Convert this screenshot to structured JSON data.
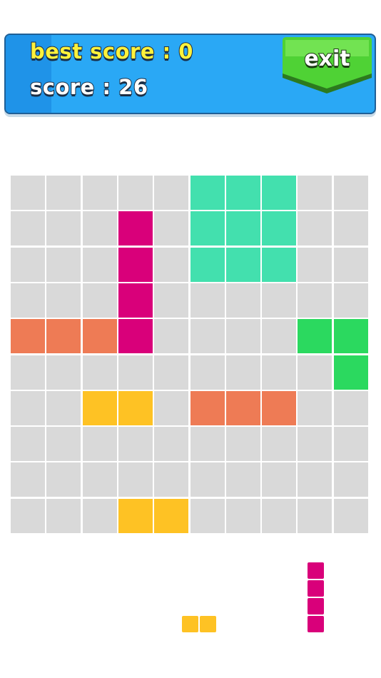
{
  "header": {
    "best_score_label": "best score : 0",
    "score_label": "score : 26",
    "exit_label": "exit"
  },
  "colors": {
    "empty": "#d9d9d9",
    "teal": "#43e0ae",
    "magenta": "#d9007a",
    "orange": "#ee7b55",
    "green": "#2bd95f",
    "yellow": "#fec224",
    "header_blue": "#2aa8f5",
    "exit_green": "#4fd235"
  },
  "board": {
    "rows": 10,
    "cols": 10,
    "cells": [
      [
        ".",
        ".",
        ".",
        ".",
        ".",
        "T",
        "T",
        "T",
        ".",
        "."
      ],
      [
        ".",
        ".",
        ".",
        "M",
        ".",
        "T",
        "T",
        "T",
        ".",
        "."
      ],
      [
        ".",
        ".",
        ".",
        "M",
        ".",
        "T",
        "T",
        "T",
        ".",
        "."
      ],
      [
        ".",
        ".",
        ".",
        "M",
        ".",
        ".",
        ".",
        ".",
        ".",
        "."
      ],
      [
        "O",
        "O",
        "O",
        "M",
        ".",
        ".",
        ".",
        ".",
        "G",
        "G"
      ],
      [
        ".",
        ".",
        ".",
        ".",
        ".",
        ".",
        ".",
        ".",
        ".",
        "G"
      ],
      [
        ".",
        ".",
        "Y",
        "Y",
        ".",
        "O",
        "O",
        "O",
        ".",
        "."
      ],
      [
        ".",
        ".",
        ".",
        ".",
        ".",
        ".",
        ".",
        ".",
        ".",
        "."
      ],
      [
        ".",
        ".",
        ".",
        ".",
        ".",
        ".",
        ".",
        ".",
        ".",
        "."
      ],
      [
        ".",
        ".",
        ".",
        "Y",
        "Y",
        ".",
        ".",
        ".",
        ".",
        "."
      ]
    ]
  },
  "tray": {
    "pieces": [
      {
        "name": "yellow-domino-piece",
        "color": "Y",
        "orientation": "horizontal",
        "length": 2
      },
      {
        "name": "magenta-bar-piece",
        "color": "M",
        "orientation": "vertical",
        "length": 4
      }
    ]
  }
}
